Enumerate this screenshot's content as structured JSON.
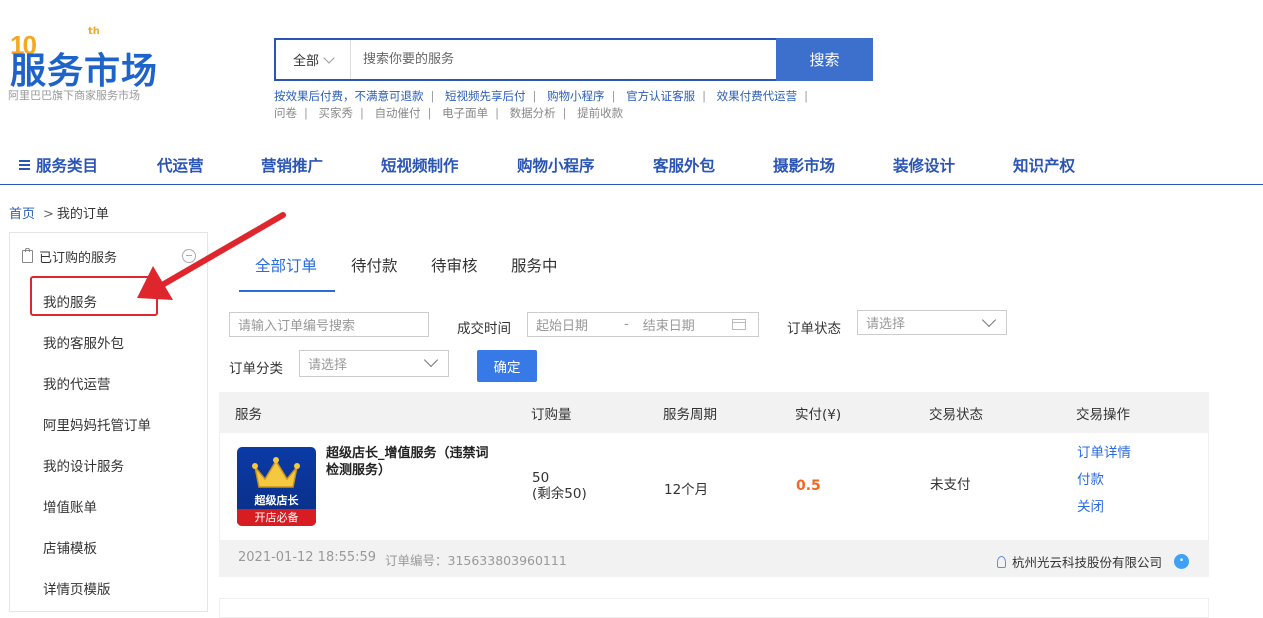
{
  "logo": {
    "badge": "10",
    "badge_sup": "th",
    "title": "服务市场",
    "subtitle": "阿里巴巴旗下商家服务市场"
  },
  "search": {
    "scope": "全部",
    "placeholder": "搜索你要的服务",
    "button": "搜索"
  },
  "hot_links": {
    "row1": [
      "按效果后付费，不满意可退款",
      "短视频先享后付",
      "购物小程序",
      "官方认证客服",
      "效果付费代运营"
    ],
    "row2": [
      "问卷",
      "买家秀",
      "自动催付",
      "电子面单",
      "数据分析",
      "提前收款"
    ]
  },
  "nav": {
    "items": [
      "服务类目",
      "代运营",
      "营销推广",
      "短视频制作",
      "购物小程序",
      "客服外包",
      "摄影市场",
      "装修设计",
      "知识产权"
    ]
  },
  "breadcrumb": {
    "home": "首页",
    "separator": ">",
    "current": "我的订单"
  },
  "sidebar": {
    "header": "已订购的服务",
    "items": [
      "我的服务",
      "我的客服外包",
      "我的代运营",
      "阿里妈妈托管订单",
      "我的设计服务",
      "增值账单",
      "店铺模板",
      "详情页模版"
    ],
    "highlight_color": "#e0262d"
  },
  "tabs": [
    "全部订单",
    "待付款",
    "待审核",
    "服务中"
  ],
  "filters": {
    "order_no_placeholder": "请输入订单编号搜索",
    "deal_time_label": "成交时间",
    "start_placeholder": "起始日期",
    "range_dash": "-",
    "end_placeholder": "结束日期",
    "status_label": "订单状态",
    "status_placeholder": "请选择",
    "category_label": "订单分类",
    "category_placeholder": "请选择",
    "confirm": "确定"
  },
  "table": {
    "headers": [
      "服务",
      "订购量",
      "服务周期",
      "实付(¥)",
      "交易状态",
      "交易操作"
    ],
    "order": {
      "image_title": "超级店长",
      "image_ribbon": "开店必备",
      "name": "超级店长_增值服务（违禁词检测服务）",
      "quantity": "50",
      "remaining": "(剩余50)",
      "period": "12个月",
      "paid": "0.5",
      "status": "未支付",
      "ops": [
        "订单详情",
        "付款",
        "关闭"
      ],
      "date": "2021-01-12 18:55:59",
      "order_no": "订单编号：315633803960111",
      "seller": "杭州光云科技股份有限公司"
    }
  },
  "colors": {
    "brand": "#2a55b4",
    "accent": "#3779e6",
    "price": "#f26722"
  }
}
